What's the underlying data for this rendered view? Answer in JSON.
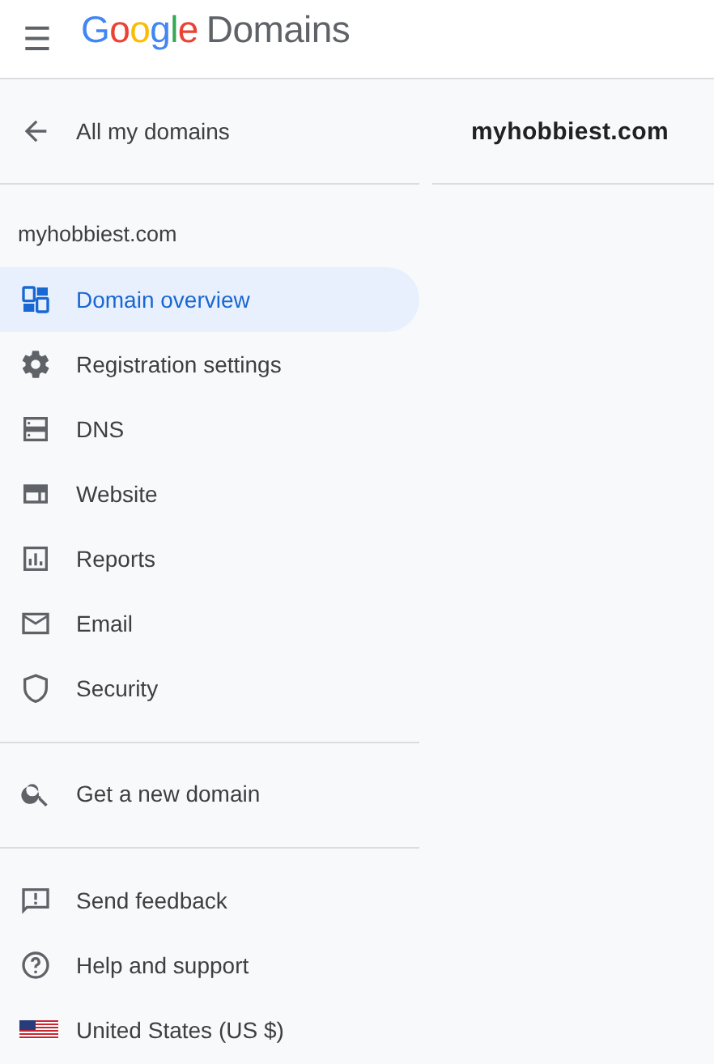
{
  "header": {
    "menu_icon": "☰",
    "brand": "Google",
    "product": "Domains"
  },
  "back_link": {
    "label": "All my domains"
  },
  "domain_label": "myhobbiest.com",
  "nav_items": [
    {
      "label": "Domain overview",
      "selected": true
    },
    {
      "label": "Registration settings",
      "selected": false
    },
    {
      "label": "DNS",
      "selected": false
    },
    {
      "label": "Website",
      "selected": false
    },
    {
      "label": "Reports",
      "selected": false
    },
    {
      "label": "Email",
      "selected": false
    },
    {
      "label": "Security",
      "selected": false
    }
  ],
  "search_item": {
    "label": "Get a new domain"
  },
  "footer_items": [
    {
      "label": "Send feedback"
    },
    {
      "label": "Help and support"
    },
    {
      "label": "United States (US $)"
    }
  ],
  "main": {
    "title": "myhobbiest.com"
  }
}
